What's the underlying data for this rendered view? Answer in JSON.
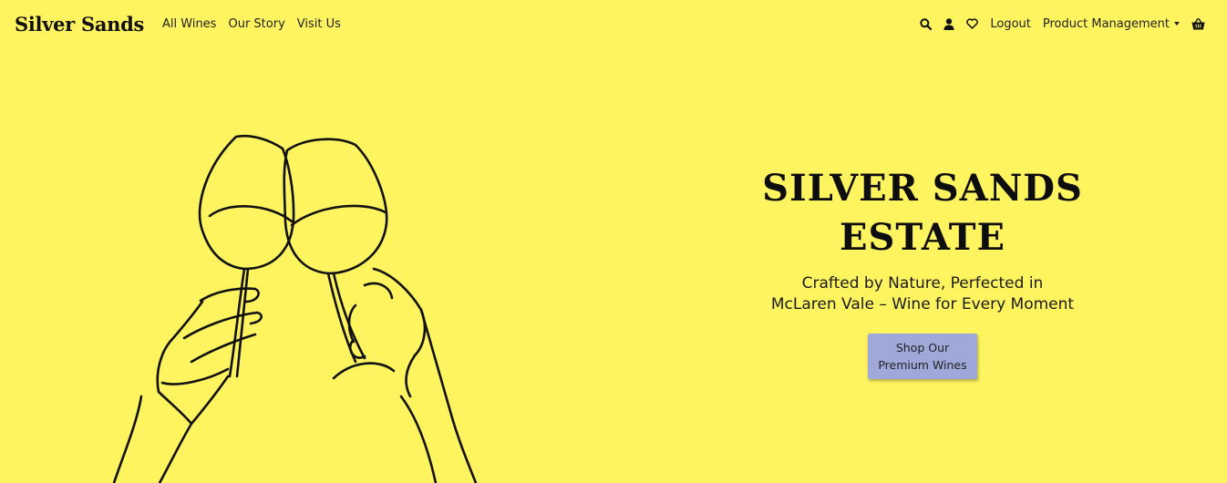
{
  "nav": {
    "brand": "Silver Sands",
    "links": [
      "All Wines",
      "Our Story",
      "Visit Us"
    ],
    "logout": "Logout",
    "product_management": "Product Management",
    "icons": [
      "search-icon",
      "user-icon",
      "heart-icon",
      "basket-icon"
    ]
  },
  "hero": {
    "title_line1": "SILVER SANDS",
    "title_line2": "ESTATE",
    "subtitle_line1": "Crafted by Nature, Perfected in",
    "subtitle_line2": "McLaren Vale – Wine for Every Moment",
    "cta_line1": "Shop Our",
    "cta_line2": "Premium Wines"
  },
  "colors": {
    "background": "#fef460",
    "button": "#9ea9d9",
    "text": "#111111"
  }
}
